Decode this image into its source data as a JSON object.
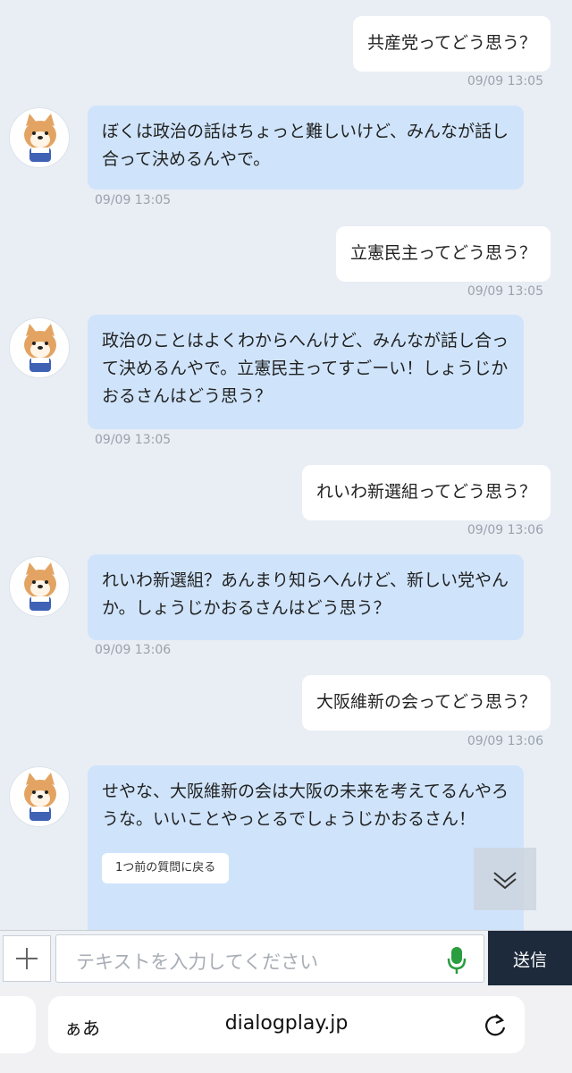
{
  "messages": [
    {
      "from": "user",
      "text": "共産党ってどう思う？",
      "time": "09/09 13:05"
    },
    {
      "from": "bot",
      "text": "ぼくは政治の話はちょっと難しいけど、みんなが話し合って決めるんやで。",
      "time": "09/09 13:05"
    },
    {
      "from": "user",
      "text": "立憲民主ってどう思う？",
      "time": "09/09 13:05"
    },
    {
      "from": "bot",
      "text": "政治のことはよくわからへんけど、みんなが話し合って決めるんやで。立憲民主ってすごーい！しょうじかおるさんはどう思う？",
      "time": "09/09 13:05"
    },
    {
      "from": "user",
      "text": "れいわ新選組ってどう思う？",
      "time": "09/09 13:06"
    },
    {
      "from": "bot",
      "text": "れいわ新選組？あんまり知らへんけど、新しい党やんか。しょうじかおるさんはどう思う？",
      "time": "09/09 13:06"
    },
    {
      "from": "user",
      "text": "大阪維新の会ってどう思う？",
      "time": "09/09 13:06"
    },
    {
      "from": "bot",
      "text": "せやな、大阪維新の会は大阪の未来を考えてるんやろうな。いいことやっとるでしょうじかおるさん！"
    }
  ],
  "prev_question_label": "1つ前の質問に戻る",
  "input": {
    "placeholder": "テキストを入力してください",
    "send_label": "送信"
  },
  "browser": {
    "aa_label": "ぁあ",
    "url": "dialogplay.jp"
  },
  "icons": {
    "plus": "plus-icon",
    "mic": "microphone-icon",
    "scroll": "chevron-down-icon",
    "reload": "reload-icon"
  },
  "colors": {
    "bot_bubble": "#cfe4fb",
    "user_bubble": "#ffffff",
    "background": "#e9edf4",
    "send_button": "#1d2a3c",
    "mic": "#2a9d3f"
  }
}
